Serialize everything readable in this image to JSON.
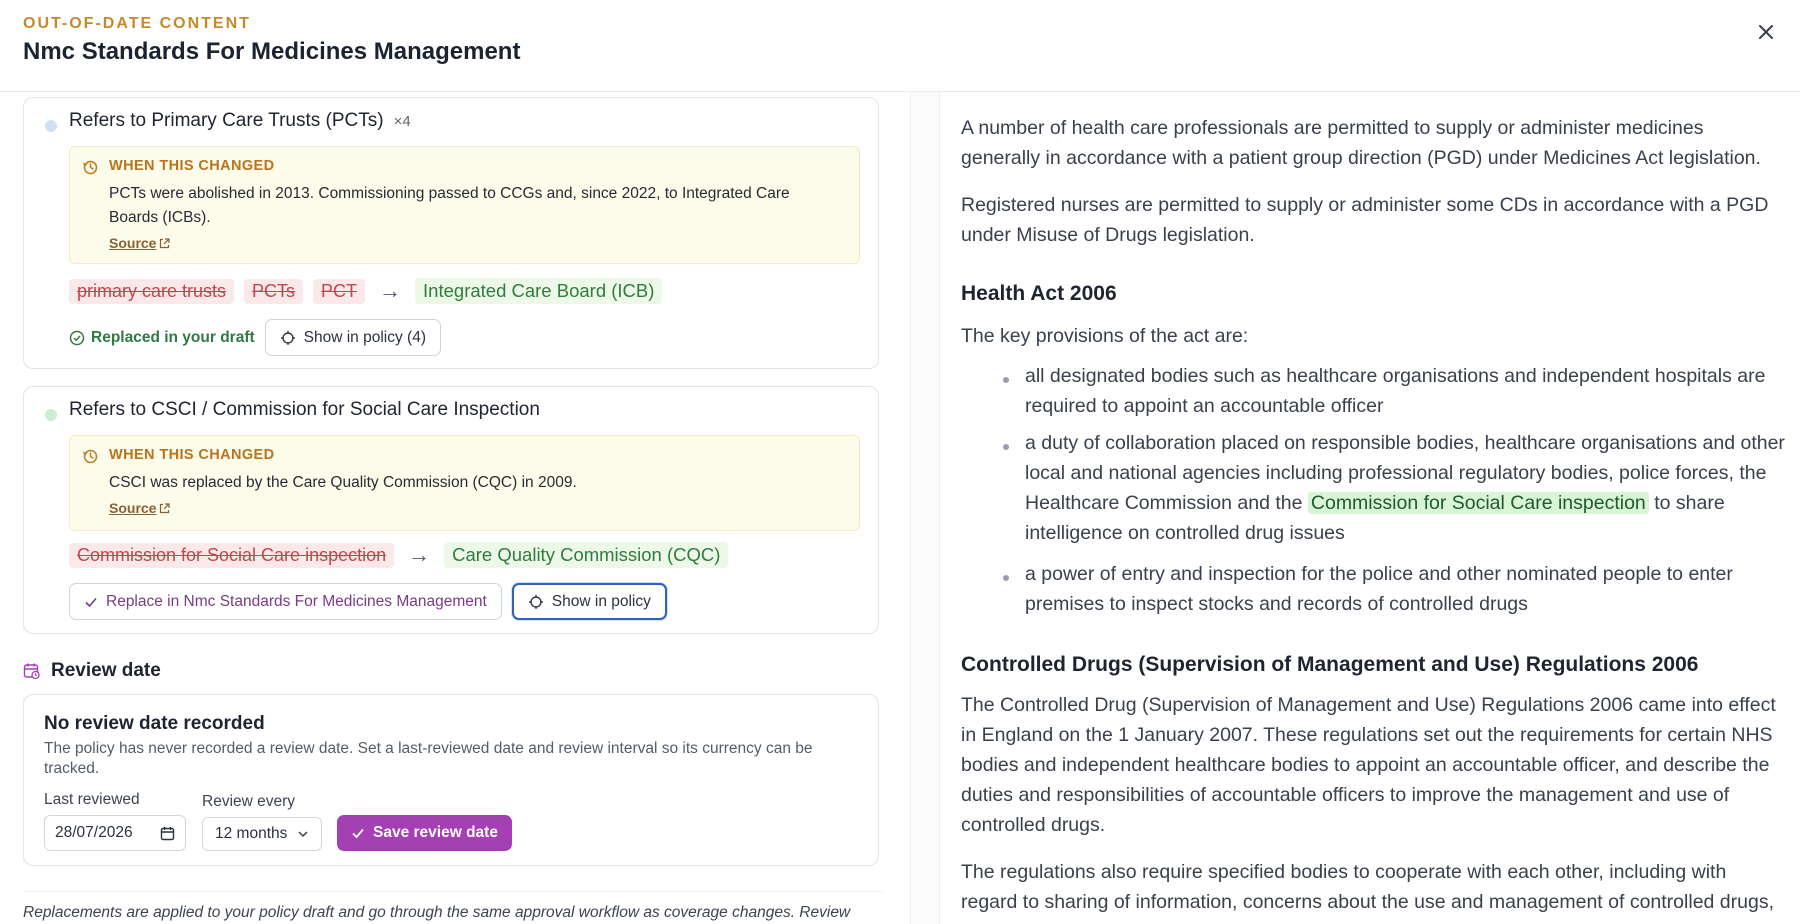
{
  "header": {
    "eyebrow": "OUT-OF-DATE CONTENT",
    "title": "Nmc Standards For Medicines Management",
    "close_icon": "close-icon"
  },
  "changes": [
    {
      "heading": "Refers to Primary Care Trusts (PCTs)",
      "count": "×4",
      "dot_color": "#cfe0f7",
      "note_label": "WHEN THIS CHANGED",
      "note_text": "PCTs were abolished in 2013. Commissioning passed to CCGs and, since 2022, to Integrated Care Boards (ICBs).",
      "source_label": "Source",
      "old_terms": [
        "primary care trusts",
        "PCTs",
        "PCT"
      ],
      "new_term": "Integrated Care Board (ICB)",
      "status": "Replaced in your draft",
      "show_label": "Show in policy (4)"
    },
    {
      "heading": "Refers to CSCI / Commission for Social Care Inspection",
      "dot_color": "#cdeed3",
      "note_label": "WHEN THIS CHANGED",
      "note_text": "CSCI was replaced by the Care Quality Commission (CQC) in 2009.",
      "source_label": "Source",
      "old_terms": [
        "Commission for Social Care inspection"
      ],
      "new_term": "Care Quality Commission (CQC)",
      "replace_label": "Replace in Nmc Standards For Medicines Management",
      "show_label": "Show in policy"
    }
  ],
  "arrow": "→",
  "review": {
    "section_title": "Review date",
    "card_title": "No review date recorded",
    "card_desc": "The policy has never recorded a review date. Set a last-reviewed date and review interval so its currency can be tracked.",
    "last_reviewed_label": "Last reviewed",
    "last_reviewed_value": "28/07/2026",
    "interval_label": "Review every",
    "interval_value": "12 months",
    "save_label": "Save review date"
  },
  "footer_note": "Replacements are applied to your policy draft and go through the same approval workflow as coverage changes. Review",
  "document": {
    "p1": "A number of health care professionals are permitted to supply or administer medicines generally in accordance with a patient group direction (PGD) under Medicines Act legislation.",
    "p2": "Registered nurses are permitted to supply or administer some CDs in accordance with a PGD under Misuse of Drugs legislation.",
    "h1": "Health Act 2006",
    "p3": "The key provisions of the act are:",
    "li1": "all designated bodies such as healthcare organisations and independent hospitals are required to appoint an accountable officer",
    "li2_before": "a duty of collaboration placed on responsible bodies, healthcare organisations and other local and national agencies including professional regulatory bodies, police forces, the Healthcare Commission and the ",
    "li2_highlight": "Commission for Social Care inspection",
    "li2_after": " to share intelligence on controlled drug issues",
    "li3": "a power of entry and inspection for the police and other nominated people to enter premises to inspect stocks and records of controlled drugs",
    "h2": "Controlled Drugs (Supervision of Management and Use) Regulations 2006",
    "p4": "The Controlled Drug (Supervision of Management and Use) Regulations 2006 came into effect in England on the 1 January 2007. These regulations set out the requirements for certain NHS bodies and independent healthcare bodies to appoint an accountable officer, and describe the duties and responsibilities of accountable officers to improve the management and use of controlled drugs.",
    "p5": "The regulations also require specified bodies to cooperate with each other, including with regard to sharing of information, concerns about the use and management of controlled drugs,"
  }
}
